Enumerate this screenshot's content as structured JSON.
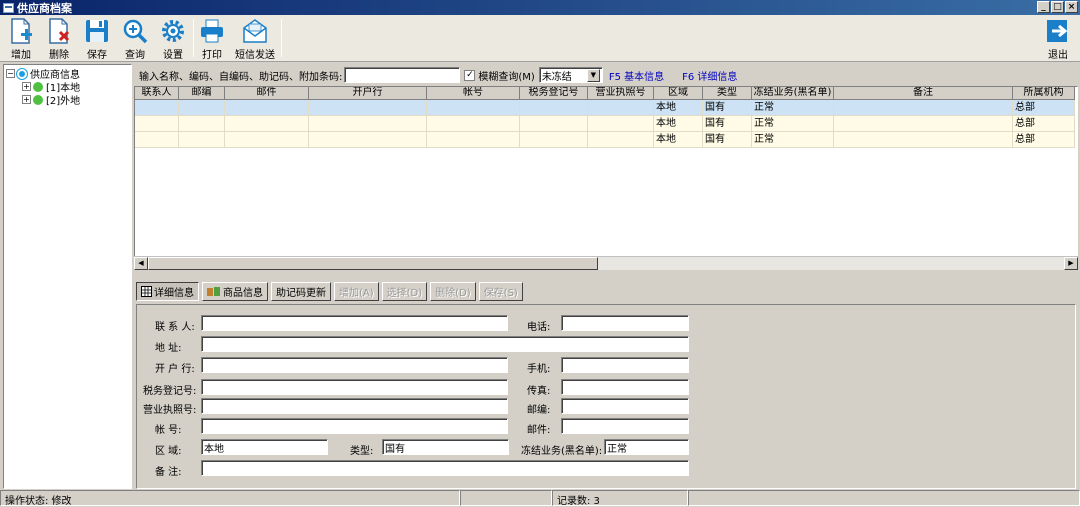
{
  "window": {
    "title": "供应商档案",
    "controls": [
      "_",
      "□",
      "×"
    ]
  },
  "toolbar": {
    "add": "增加",
    "delete": "删除",
    "save": "保存",
    "query": "查询",
    "settings": "设置",
    "print": "打印",
    "sms": "短信发送",
    "exit": "退出"
  },
  "tree": {
    "root": "供应商信息",
    "children": [
      "[1]本地",
      "[2]外地"
    ]
  },
  "search": {
    "label": "输入名称、编码、自编码、助记码、附加条码:",
    "value": "",
    "fuzzy_label": "模糊查询(M)",
    "fuzzy_checked": "✓",
    "freeze_value": "未冻结",
    "f5": "F5 基本信息",
    "f6": "F6 详细信息"
  },
  "grid": {
    "columns": [
      "联系人",
      "邮编",
      "邮件",
      "开户行",
      "帐号",
      "税务登记号",
      "营业执照号",
      "区域",
      "类型",
      "冻结业务(黑名单)",
      "备注",
      "所属机构"
    ],
    "rows": [
      [
        "",
        "",
        "",
        "",
        "",
        "",
        "",
        "本地",
        "国有",
        "正常",
        "",
        "总部"
      ],
      [
        "",
        "",
        "",
        "",
        "",
        "",
        "",
        "本地",
        "国有",
        "正常",
        "",
        "总部"
      ],
      [
        "",
        "",
        "",
        "",
        "",
        "",
        "",
        "本地",
        "国有",
        "正常",
        "",
        "总部"
      ]
    ],
    "scroll_left": "◀",
    "scroll_right": "▶"
  },
  "tabs": {
    "detail": "详细信息",
    "goods": "商品信息",
    "mnemonic_update": "助记码更新",
    "add": "增加(A)",
    "select": "选择(D)",
    "delete": "删除(D)",
    "save": "保存(S)"
  },
  "form": {
    "contact_label": "联 系 人:",
    "contact_value": "",
    "phone_label": "电话:",
    "phone_value": "",
    "address_label": "地    址:",
    "address_value": "",
    "bank_label": "开 户 行:",
    "bank_value": "",
    "mobile_label": "手机:",
    "mobile_value": "",
    "tax_label": "税务登记号:",
    "tax_value": "",
    "fax_label": "传真:",
    "fax_value": "",
    "license_label": "营业执照号:",
    "license_value": "",
    "zip_label": "邮编:",
    "zip_value": "",
    "account_label": "帐    号:",
    "account_value": "",
    "email_label": "邮件:",
    "email_value": "",
    "region_label": "区    域:",
    "region_value": "本地",
    "type_label": "类型:",
    "type_value": "国有",
    "freeze_label": "冻结业务(黑名单):",
    "freeze_value": "正常",
    "remark_label": "备    注:",
    "remark_value": ""
  },
  "status": {
    "op_state": "操作状态: 修改",
    "record_count": "记录数: 3"
  },
  "colors": {
    "titlebar": "#0a246a",
    "selected_row": "#cde3f5",
    "grid_row": "#fffbe6",
    "fkey": "#0000c0"
  }
}
